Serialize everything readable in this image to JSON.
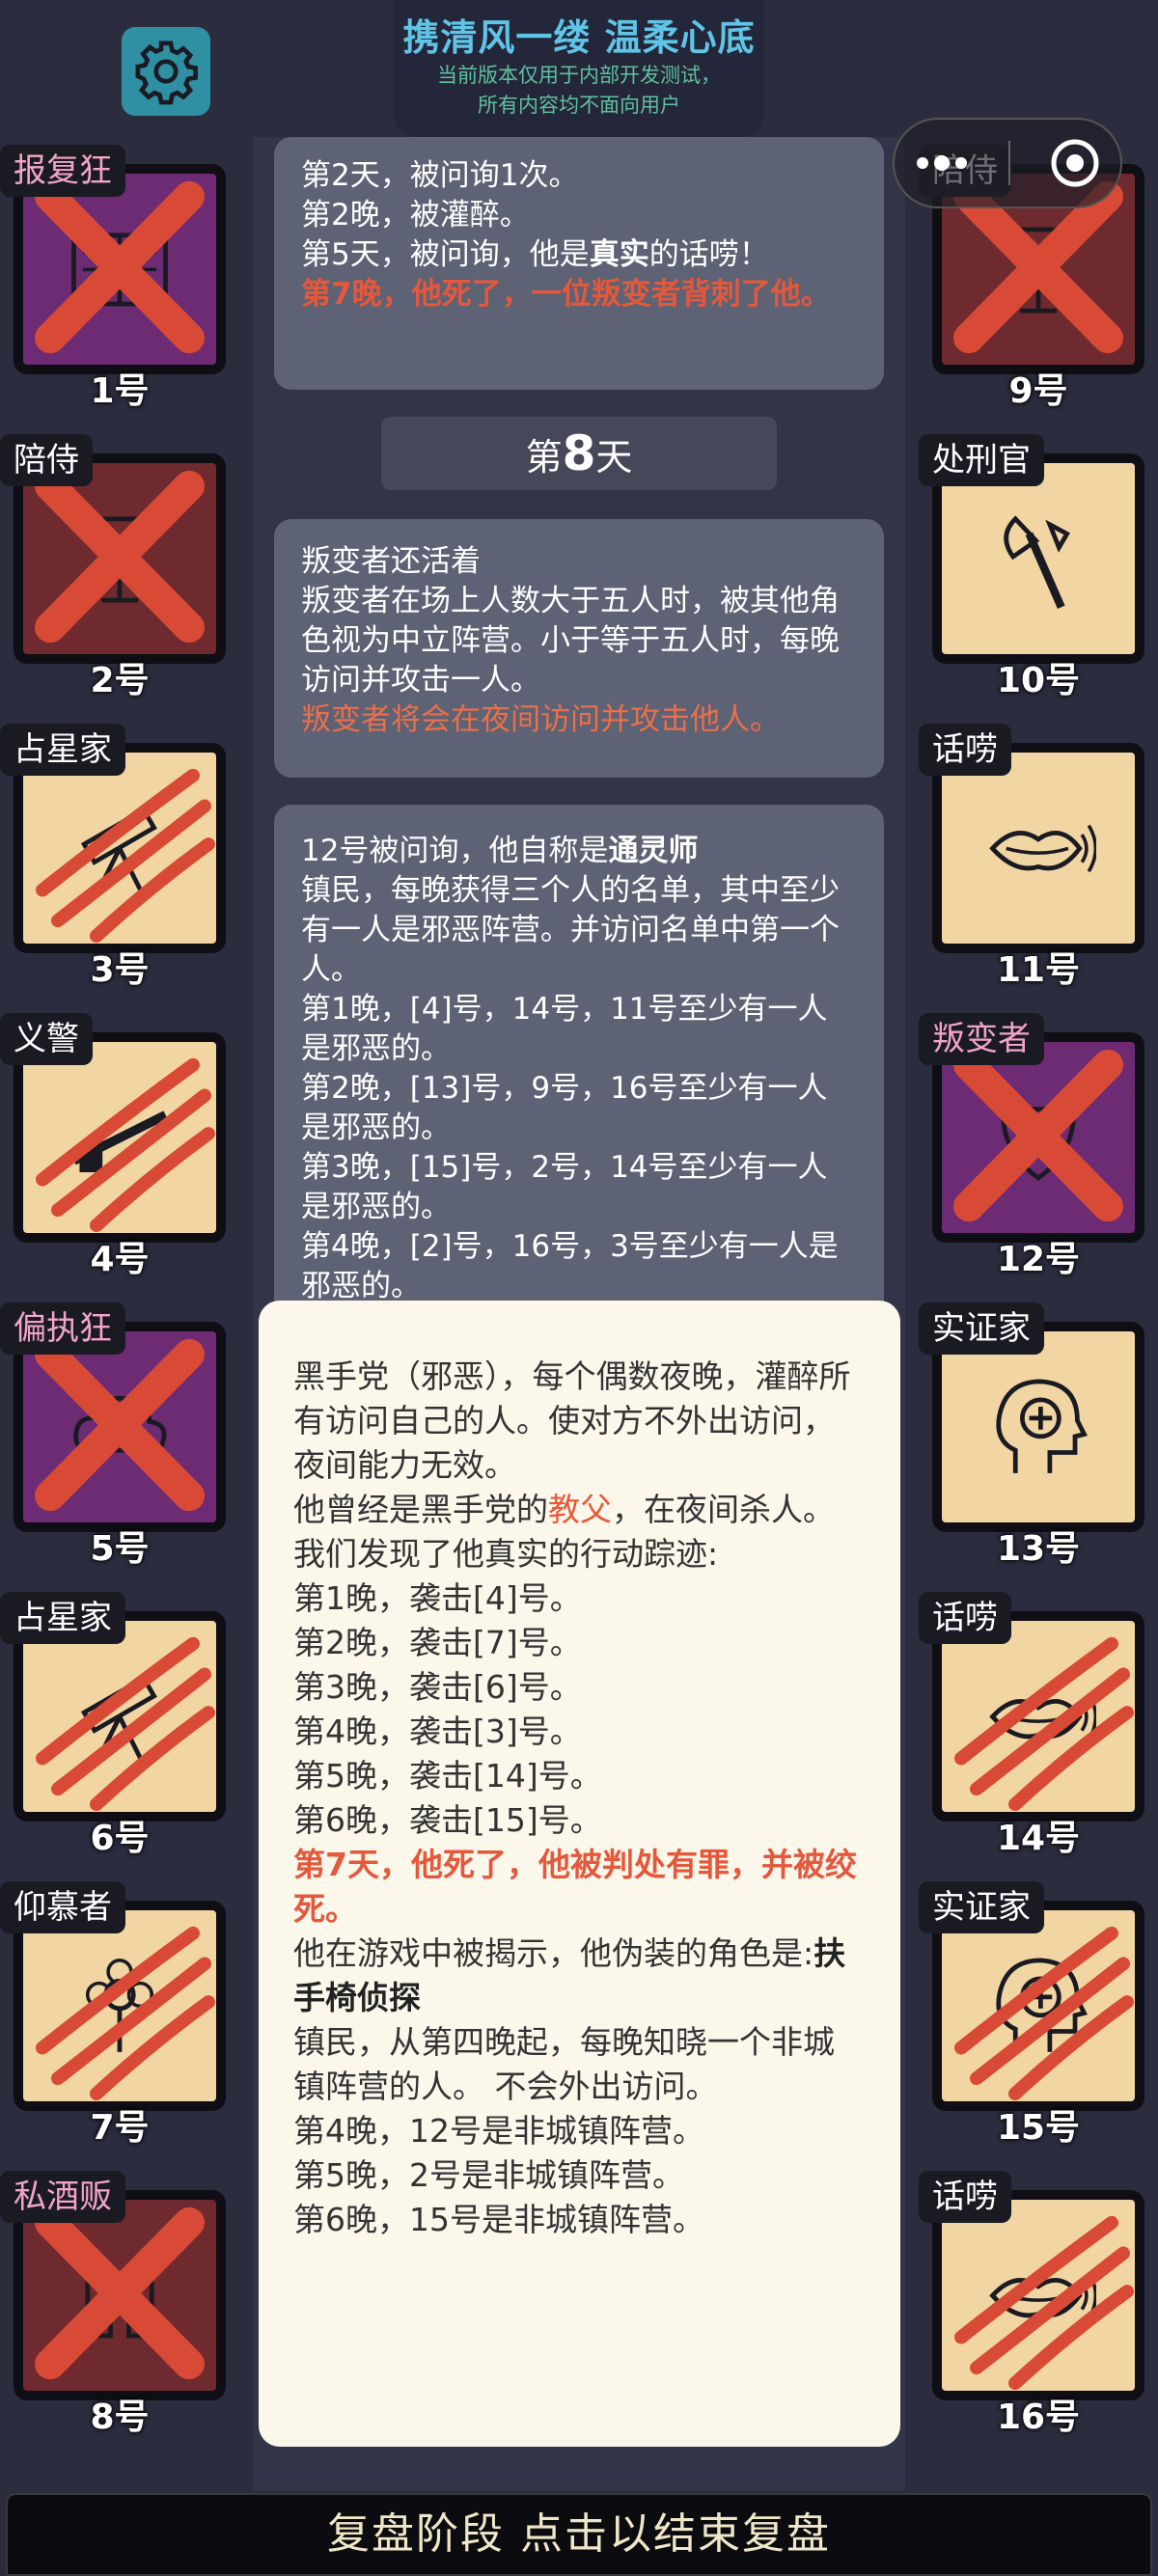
{
  "header": {
    "title": "携清风一缕 温柔心底",
    "notice_line1": "当前版本仅用于内部开发测试，",
    "notice_line2": "所有内容均不面向用户"
  },
  "log": {
    "card1": {
      "line1": "第2天，被问询1次。",
      "line2": "第2晚，被灌醉。",
      "line3_prefix": "第5天，被问询，他是",
      "line3_bold": "真实",
      "line3_suffix": "的话唠！",
      "line4": "第7晚，他死了，一位叛变者背刺了他。"
    },
    "day_prefix": "第",
    "day_number": "8",
    "day_suffix": "天",
    "card2": {
      "line1": "叛变者还活着",
      "line2": "叛变者在场上人数大于五人时，被其他角色视为中立阵营。小于等于五人时，每晚访问并攻击一人。",
      "line3": "叛变者将会在夜间访问并攻击他人。"
    },
    "card3": {
      "line1_prefix": "12号被问询，他自称是",
      "line1_bold": "通灵师",
      "line2": "镇民，每晚获得三个人的名单，其中至少有一人是邪恶阵营。并访问名单中第一个人。",
      "line3": "第1晚，[4]号，14号，11号至少有一人是邪恶的。",
      "line4": "第2晚，[13]号，9号，16号至少有一人是邪恶的。",
      "line5": "第3晚，[15]号，2号，14号至少有一人是邪恶的。",
      "line6": "第4晚，[2]号，16号，3号至少有一人是邪恶的。"
    }
  },
  "detail": {
    "p1": "黑手党（邪恶），每个偶数夜晚，灌醉所有访问自己的人。使对方不外出访问，夜间能力无效。",
    "p2_prefix": "他曾经是黑手党的",
    "p2_highlight": "教父",
    "p2_suffix": "，在夜间杀人。",
    "p3": "我们发现了他真实的行动踪迹:",
    "nights": [
      "第1晚，袭击[4]号。",
      "第2晚，袭击[7]号。",
      "第3晚，袭击[6]号。",
      "第4晚，袭击[3]号。",
      "第5晚，袭击[14]号。",
      "第6晚，袭击[15]号。"
    ],
    "death": "第7天，他死了，他被判处有罪，并被绞死。",
    "reveal_prefix": "他在游戏中被揭示，他伪装的角色是:",
    "reveal_role": "扶手椅侦探",
    "reveal_desc": "镇民，从第四晚起，每晚知晓一个非城镇阵营的人。 不会外出访问。",
    "findings": [
      "第4晚，12号是非城镇阵营。",
      "第5晚，2号是非城镇阵营。",
      "第6晚，15号是非城镇阵营。"
    ]
  },
  "players": [
    {
      "role": "报复狂",
      "number": "1号",
      "icon": "book-icon",
      "status": "cross"
    },
    {
      "role": "陪侍",
      "number": "2号",
      "icon": "wine-glass-icon",
      "status": "cross"
    },
    {
      "role": "占星家",
      "number": "3号",
      "icon": "telescope-icon",
      "status": "claw"
    },
    {
      "role": "义警",
      "number": "4号",
      "icon": "rifle-icon",
      "status": "claw"
    },
    {
      "role": "偏执狂",
      "number": "5号",
      "icon": "cloud-icon",
      "status": "cross"
    },
    {
      "role": "占星家",
      "number": "6号",
      "icon": "telescope-icon",
      "status": "claw"
    },
    {
      "role": "仰慕者",
      "number": "7号",
      "icon": "flower-icon",
      "status": "claw"
    },
    {
      "role": "私酒贩",
      "number": "8号",
      "icon": "bottles-icon",
      "status": "cross"
    },
    {
      "role": "陪侍",
      "number": "9号",
      "icon": "wine-glass-icon",
      "status": "cross"
    },
    {
      "role": "处刑官",
      "number": "10号",
      "icon": "axe-icon",
      "status": "alive"
    },
    {
      "role": "话唠",
      "number": "11号",
      "icon": "mouth-icon",
      "status": "alive"
    },
    {
      "role": "叛变者",
      "number": "12号",
      "icon": "mask-icon",
      "status": "cross"
    },
    {
      "role": "实证家",
      "number": "13号",
      "icon": "head-plus-icon",
      "status": "alive"
    },
    {
      "role": "话唠",
      "number": "14号",
      "icon": "mouth-icon",
      "status": "claw"
    },
    {
      "role": "实证家",
      "number": "15号",
      "icon": "head-plus-icon",
      "status": "claw"
    },
    {
      "role": "话唠",
      "number": "16号",
      "icon": "mouth-icon",
      "status": "claw"
    }
  ],
  "footer": {
    "label": "复盘阶段 点击以结束复盘"
  },
  "colors": {
    "background": "#2b2d3f",
    "card_cream": "#f1d5a2",
    "card_purple": "#6d2b74",
    "card_maroon": "#6e2a2e",
    "mark_red": "#d84a36",
    "highlight_red": "#e4583c"
  }
}
